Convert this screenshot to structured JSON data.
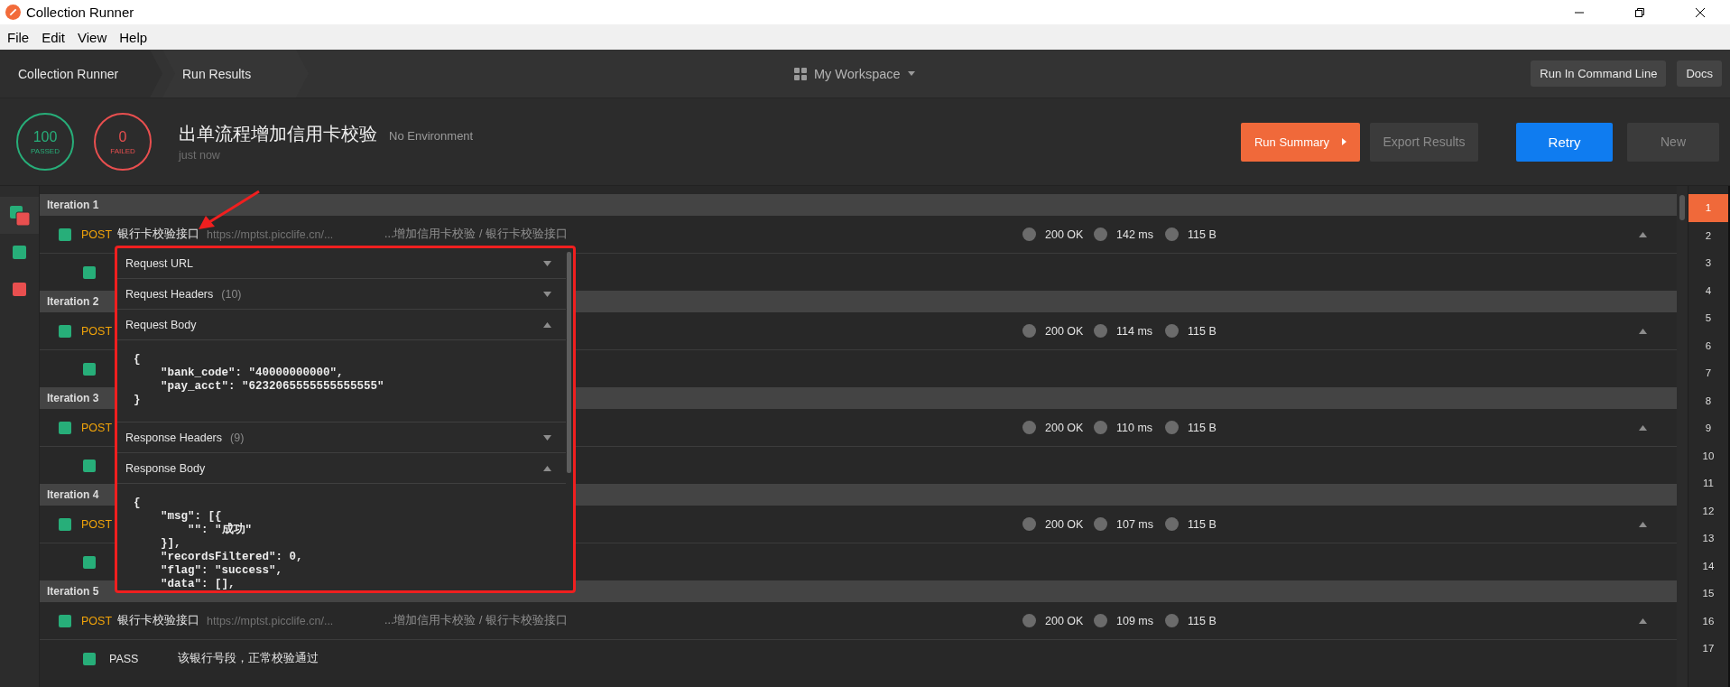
{
  "window": {
    "title": "Collection Runner"
  },
  "menu": [
    "File",
    "Edit",
    "View",
    "Help"
  ],
  "breadcrumbs": [
    "Collection Runner",
    "Run Results"
  ],
  "workspace": {
    "label": "My Workspace"
  },
  "header_buttons": [
    "Run In Command Line",
    "Docs"
  ],
  "summary": {
    "passed": {
      "count": "100",
      "label": "PASSED"
    },
    "failed": {
      "count": "0",
      "label": "FAILED"
    },
    "collection": "出单流程增加信用卡校验",
    "environment": "No Environment",
    "time": "just now"
  },
  "actions": [
    {
      "label": "Run Summary",
      "kind": "menu",
      "disabled": false
    },
    {
      "label": "Export Results",
      "kind": "plain",
      "disabled": true
    },
    {
      "label": "Retry",
      "kind": "accent",
      "disabled": false
    },
    {
      "label": "New",
      "kind": "plain",
      "disabled": true
    }
  ],
  "sidebar": [
    {
      "kind": "double",
      "squares": [
        {
          "color": "#27ae79"
        },
        {
          "color": "#e94f4f"
        }
      ]
    },
    {
      "kind": "single",
      "color": "#27ae79"
    },
    {
      "kind": "single",
      "color": "#e94f4f"
    }
  ],
  "iterations": [
    {
      "title": "Iteration 1",
      "request": {
        "passed": true,
        "method": "POST",
        "name": "银行卡校验接口",
        "url": "https://mptst.picclife.cn/...",
        "path": "...增加信用卡校验 / 银行卡校验接口",
        "code": "200 OK",
        "time": "142 ms",
        "size": "115 B",
        "expanded": true
      },
      "tests": [
        {
          "passed": true
        }
      ]
    },
    {
      "title": "Iteration 2",
      "request": {
        "passed": true,
        "method": "POST",
        "code": "200 OK",
        "time": "114 ms",
        "size": "115 B",
        "expanded": true
      },
      "tests": [
        {
          "passed": true
        }
      ]
    },
    {
      "title": "Iteration 3",
      "request": {
        "passed": true,
        "method": "POST",
        "code": "200 OK",
        "time": "110 ms",
        "size": "115 B",
        "expanded": true
      },
      "tests": [
        {
          "passed": true
        }
      ]
    },
    {
      "title": "Iteration 4",
      "request": {
        "passed": true,
        "method": "POST",
        "code": "200 OK",
        "time": "107 ms",
        "size": "115 B",
        "expanded": true
      },
      "tests": [
        {
          "passed": true
        }
      ]
    },
    {
      "title": "Iteration 5",
      "request": {
        "passed": true,
        "method": "POST",
        "name": "银行卡校验接口",
        "url": "https://mptst.picclife.cn/...",
        "path": "...增加信用卡校验 / 银行卡校验接口",
        "code": "200 OK",
        "time": "109 ms",
        "size": "115 B",
        "expanded": true
      },
      "tests": [
        {
          "passed": true,
          "result": "PASS",
          "message": "该银行号段，正常校验通过"
        }
      ]
    }
  ],
  "popup": {
    "sections": [
      {
        "title": "Request URL",
        "expanded": false
      },
      {
        "title": "Request Headers",
        "count": "(10)",
        "expanded": false
      },
      {
        "title": "Request Body",
        "expanded": true,
        "body": "{\n    \"bank_code\": \"40000000000\",\n    \"pay_acct\": \"6232065555555555555\"\n}"
      },
      {
        "title": "Response Headers",
        "count": "(9)",
        "expanded": false
      },
      {
        "title": "Response Body",
        "expanded": true,
        "body": "{\n    \"msg\": [{\n        \"\": \"成功\"\n    }],\n    \"recordsFiltered\": 0,\n    \"flag\": \"success\",\n    \"data\": [],"
      }
    ]
  },
  "pages": [
    {
      "label": "1",
      "selected": true
    },
    {
      "label": "2",
      "selected": false
    },
    {
      "label": "3",
      "selected": false
    },
    {
      "label": "4",
      "selected": false
    },
    {
      "label": "5",
      "selected": false
    },
    {
      "label": "6",
      "selected": false
    },
    {
      "label": "7",
      "selected": false
    },
    {
      "label": "8",
      "selected": false
    },
    {
      "label": "9",
      "selected": false
    },
    {
      "label": "10",
      "selected": false
    },
    {
      "label": "11",
      "selected": false
    },
    {
      "label": "12",
      "selected": false
    },
    {
      "label": "13",
      "selected": false
    },
    {
      "label": "14",
      "selected": false
    },
    {
      "label": "15",
      "selected": false
    },
    {
      "label": "16",
      "selected": false
    },
    {
      "label": "17",
      "selected": false
    }
  ]
}
